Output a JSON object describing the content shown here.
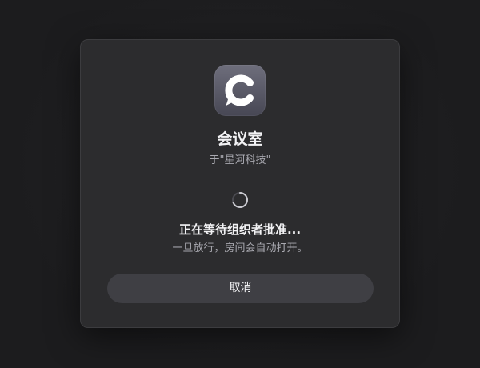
{
  "app": {
    "icon": "chat-bubble-c-icon",
    "name": "会议室",
    "organization_line": "于\"星河科技\""
  },
  "status": {
    "indicator": "loading-spinner-icon",
    "title": "正在等待组织者批准...",
    "subtitle": "一旦放行，房间会自动打开。"
  },
  "actions": {
    "cancel_label": "取消"
  },
  "colors": {
    "background": "#1c1c1e",
    "dialog": "#2c2c2e",
    "button": "#3f3f44",
    "primary_text": "#f2f2f4",
    "secondary_text": "#a9a9b0"
  }
}
